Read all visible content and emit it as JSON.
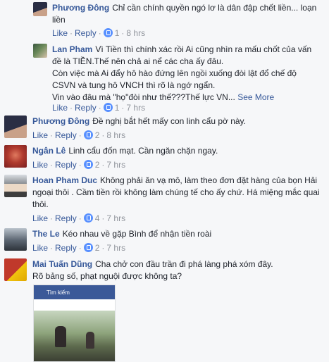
{
  "comments": [
    {
      "name": "Phương Đông",
      "text": "Chỉ cần chính quyền ngó lơ là dân đập chết liền... loạn liền",
      "like": "Like",
      "reply": "Reply",
      "reactions": "1",
      "time": "8 hrs",
      "avatar_colors": [
        "#2a2e44",
        "#c9a189"
      ]
    },
    {
      "name": "Lan Pham",
      "text": "Vì Tiền thì chính xác rồi Ai cũng nhìn ra mấu chốt của vấn đề là TIỀN.Thế nên chả ai nể các cha ấy đâu.",
      "text2": "Còn việc mà Ai đẩy hô hào đứng lên ngồi xuống đòi lật đổ chế độ CSVN và tung hô VNCH thì rõ là ngớ ngẩn.",
      "text3": "Vin vào đâu mà \"họ\"đòi như thế???Thế lực VN...",
      "see_more": "See More",
      "like": "Like",
      "reply": "Reply",
      "reactions": "1",
      "time": "7 hrs",
      "avatar_colors": [
        "#3a5740",
        "#d7c2ad"
      ]
    },
    {
      "name": "Phương Đông",
      "text": "Đề nghị bắt hết mấy con linh cẩu pờ này.",
      "like": "Like",
      "reply": "Reply",
      "reactions": "2",
      "time": "8 hrs",
      "avatar_colors": [
        "#2a2e44",
        "#c9a189"
      ]
    },
    {
      "name": "Ngân Lê",
      "text": "Linh cẩu đốn mạt. Cần ngăn chặn ngay.",
      "like": "Like",
      "reply": "Reply",
      "reactions": "2",
      "time": "7 hrs",
      "avatar_colors": [
        "#7a1f1f",
        "#e07a5f"
      ]
    },
    {
      "name": "Hoan Pham Duc",
      "text": "Không phải ăn vạ mô, làm theo đơn đặt hàng của bọn Hải ngoại thôi . Cầm tiền rồi không làm chúng tế cho ấy chứ. Há miệng mắc quai thôi.",
      "like": "Like",
      "reply": "Reply",
      "reactions": "4",
      "time": "7 hrs",
      "avatar_colors": [
        "#8b8f94",
        "#ecd9c6"
      ]
    },
    {
      "name": "The Le",
      "text": "Kéo nhau về gặp Bình để nhận tiền roài",
      "like": "Like",
      "reply": "Reply",
      "reactions": "2",
      "time": "7 hrs",
      "avatar_colors": [
        "#5a6470",
        "#9aa4ae"
      ]
    },
    {
      "name": "Mai Tuấn Dũng",
      "text": "Cha chở con đầu trần đi phá làng phá xóm đây.",
      "text2": "Rõ bảng số, phạt nguội được không ta?",
      "avatar_colors": [
        "#c0392b",
        "#f1c40f"
      ],
      "attachment_search_label": "Tìm kiếm"
    }
  ]
}
